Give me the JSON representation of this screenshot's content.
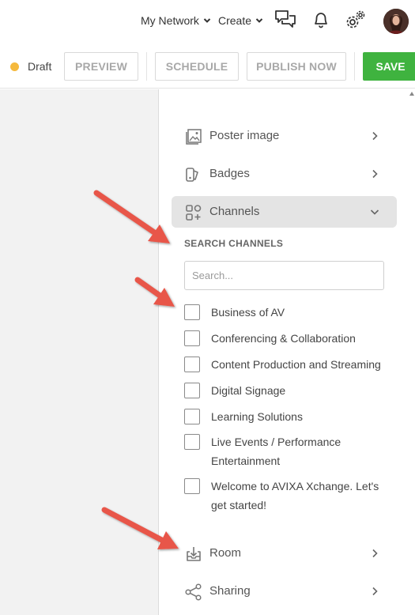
{
  "nav": {
    "my_network": "My Network",
    "create": "Create",
    "icons": [
      "chat-icon",
      "bell-icon",
      "settings-gear-icon",
      "user-avatar"
    ]
  },
  "toolbar": {
    "status": "Draft",
    "status_color": "#f5b93d",
    "preview": "PREVIEW",
    "schedule": "SCHEDULE",
    "publish_now": "PUBLISH NOW",
    "save": "SAVE",
    "save_color": "#3fb33f"
  },
  "panel": {
    "items": [
      {
        "label": "Poster image",
        "icon": "image-icon"
      },
      {
        "label": "Badges",
        "icon": "badge-icon"
      },
      {
        "label": "Channels",
        "icon": "channels-grid-icon",
        "expanded": true
      }
    ],
    "search_section_label": "SEARCH CHANNELS",
    "search_placeholder": "Search...",
    "channels": [
      "Business of AV",
      "Conferencing & Collaboration",
      "Content Production and Streaming",
      "Digital Signage",
      "Learning Solutions",
      "Live Events / Performance Entertainment",
      "Welcome to AVIXA Xchange. Let's get started!"
    ],
    "bottom_items": [
      {
        "label": "Room",
        "icon": "room-download-icon"
      },
      {
        "label": "Sharing",
        "icon": "share-icon"
      }
    ]
  },
  "annotation_arrow_color": "#e8574a"
}
